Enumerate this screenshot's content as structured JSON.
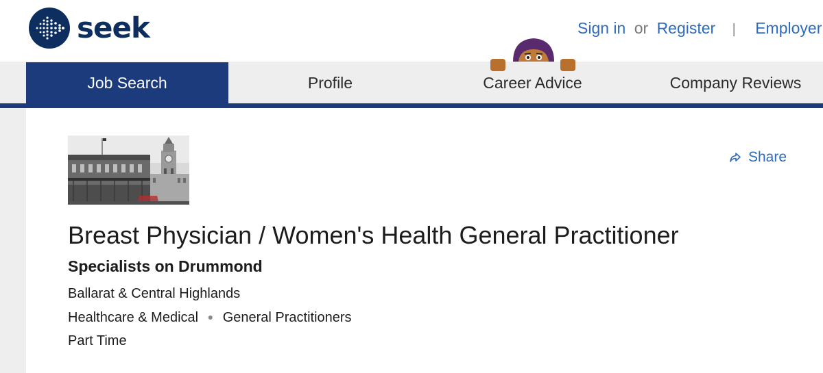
{
  "header": {
    "logo_text": "seek",
    "sign_in": "Sign in",
    "or_text": "or",
    "register": "Register",
    "separator": "|",
    "employer_site": "Employer si"
  },
  "nav": {
    "tabs": [
      {
        "label": "Job Search",
        "active": true
      },
      {
        "label": "Profile",
        "active": false
      },
      {
        "label": "Career Advice",
        "active": false
      },
      {
        "label": "Company Reviews",
        "active": false
      }
    ]
  },
  "job": {
    "share_label": "Share",
    "title": "Breast Physician / Women's Health General Practitioner",
    "company": "Specialists on Drummond",
    "location": "Ballarat & Central Highlands",
    "classification": "Healthcare & Medical",
    "sub_classification": "General Practitioners",
    "work_type": "Part Time"
  },
  "colors": {
    "brand_navy": "#1b3b7d",
    "link_blue": "#2e6bc0",
    "nav_bg": "#eeeeee"
  },
  "icons": [
    "seek-logo-icon",
    "mascot-peeking-icon",
    "share-icon"
  ]
}
